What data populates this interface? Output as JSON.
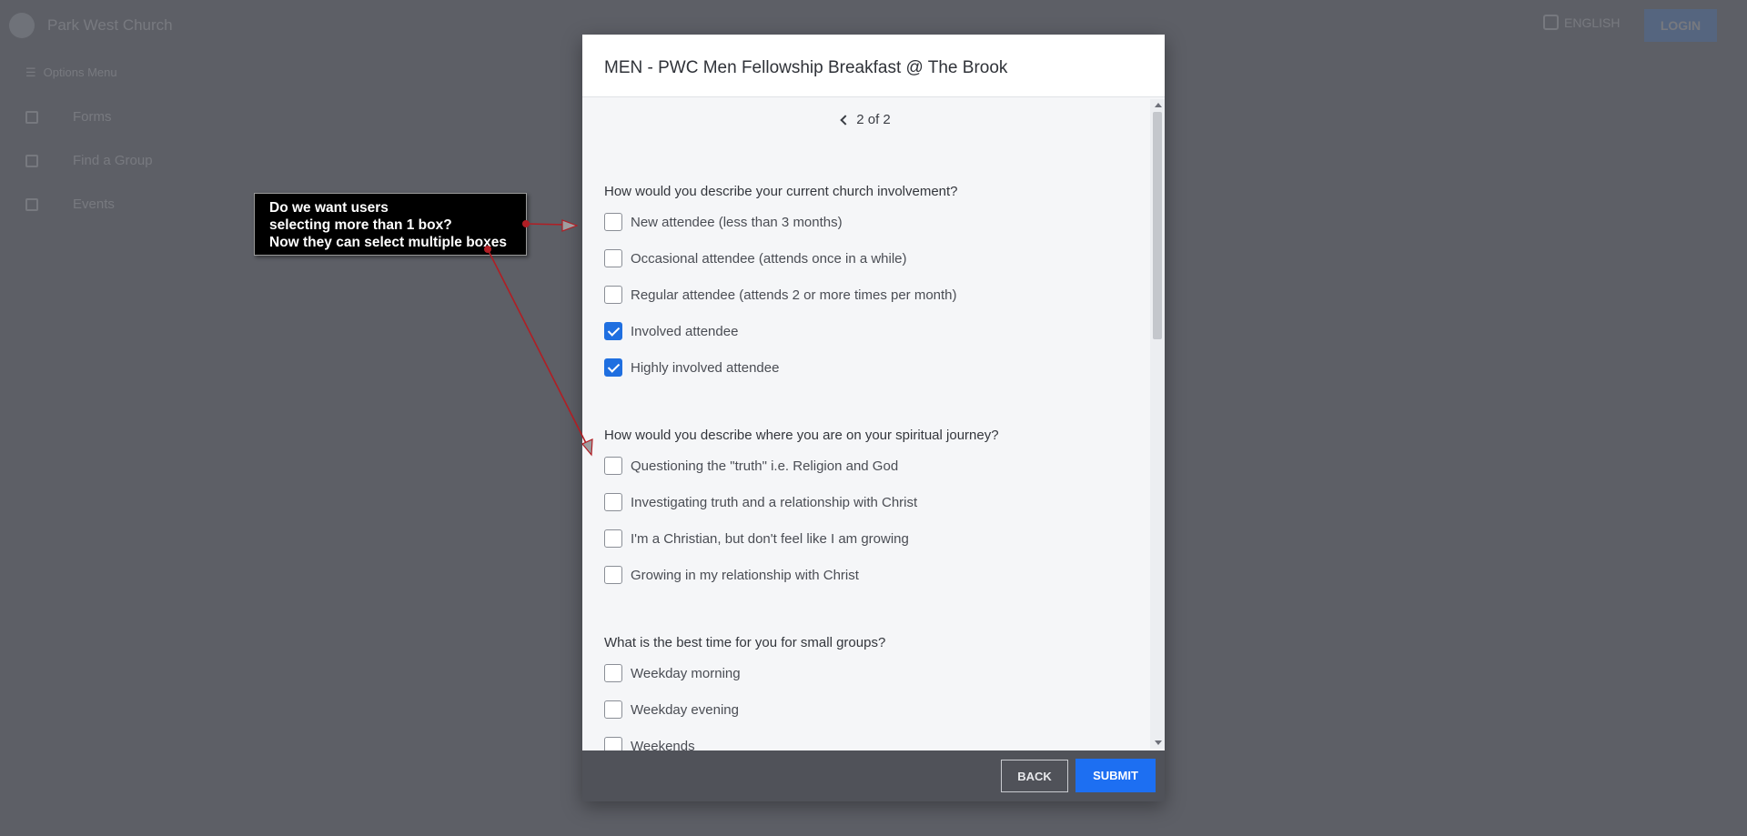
{
  "background": {
    "church_name": "Park West Church",
    "language_label": "ENGLISH",
    "login_label": "LOGIN",
    "options_menu_label": "Options Menu",
    "nav_items": [
      {
        "label": "Forms",
        "icon": "forms-icon"
      },
      {
        "label": "Find a Group",
        "icon": "group-icon"
      },
      {
        "label": "Events",
        "icon": "calendar-icon"
      }
    ]
  },
  "annotation": {
    "lines": [
      "Do we want users",
      "selecting more than 1 box?",
      "Now they can select multiple boxes"
    ],
    "arrow_color": "#b01e24"
  },
  "modal": {
    "title": "MEN - PWC Men Fellowship Breakfast @ The Brook",
    "pager": "2 of 2",
    "questions": [
      {
        "text": "How would you describe your current church involvement?",
        "options": [
          {
            "label": "New attendee (less than 3 months)",
            "checked": false
          },
          {
            "label": "Occasional attendee (attends once in a while)",
            "checked": false
          },
          {
            "label": "Regular attendee (attends 2 or more times per month)",
            "checked": false
          },
          {
            "label": "Involved attendee",
            "checked": true
          },
          {
            "label": "Highly involved attendee",
            "checked": true
          }
        ]
      },
      {
        "text": "How would you describe where you are on your spiritual journey?",
        "options": [
          {
            "label": "Questioning the \"truth\" i.e. Religion and God",
            "checked": false
          },
          {
            "label": "Investigating truth and a relationship with Christ",
            "checked": false
          },
          {
            "label": "I'm a Christian, but don't feel like I am growing",
            "checked": false
          },
          {
            "label": "Growing in my relationship with Christ",
            "checked": false
          }
        ]
      },
      {
        "text": "What is the best time for you for small groups?",
        "options": [
          {
            "label": "Weekday morning",
            "checked": false
          },
          {
            "label": "Weekday evening",
            "checked": false
          },
          {
            "label": "Weekends",
            "checked": false
          }
        ]
      }
    ],
    "back_label": "BACK",
    "submit_label": "SUBMIT",
    "colors": {
      "checkbox_checked": "#1f6fe0",
      "submit": "#1d6ff2",
      "footer": "#505259"
    }
  }
}
